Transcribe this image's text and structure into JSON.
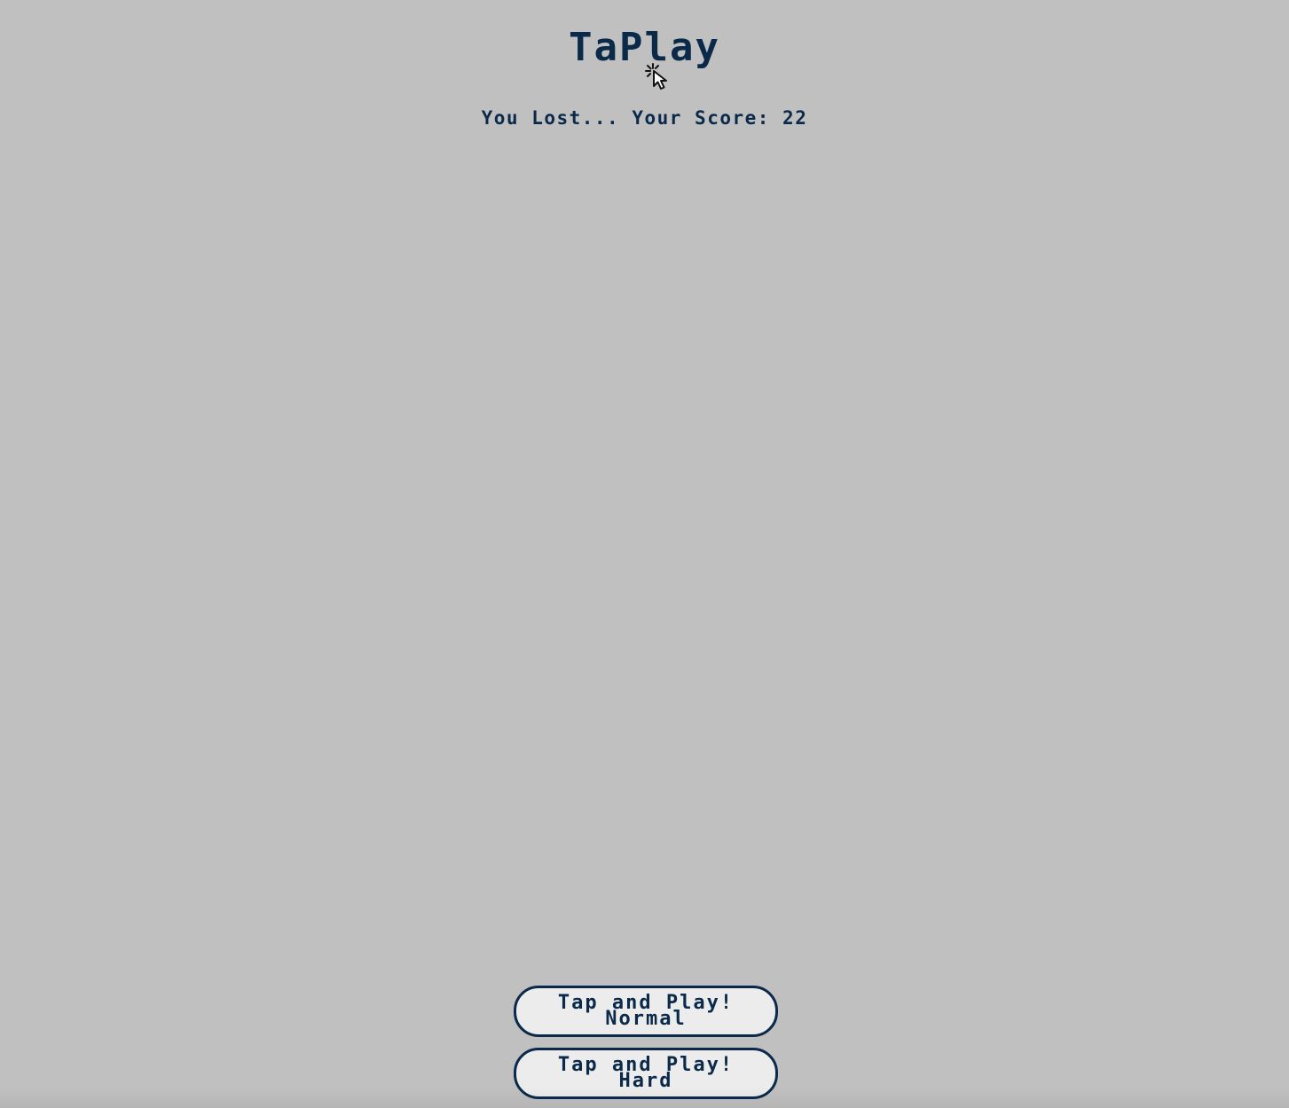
{
  "app": {
    "title": "TaPlay"
  },
  "status": {
    "message": "You Lost... Your Score: 22"
  },
  "buttons": {
    "normal": {
      "line1": "Tap and Play!",
      "line2": "Normal"
    },
    "hard": {
      "line1": "Tap and Play!",
      "line2": "Hard"
    }
  },
  "icons": {
    "logo_cursor": "cursor-click-icon"
  },
  "colors": {
    "background": "#c0c0c0",
    "text": "#0b2a4a",
    "button_fill": "#ececec",
    "button_border": "#0b2a4a"
  }
}
